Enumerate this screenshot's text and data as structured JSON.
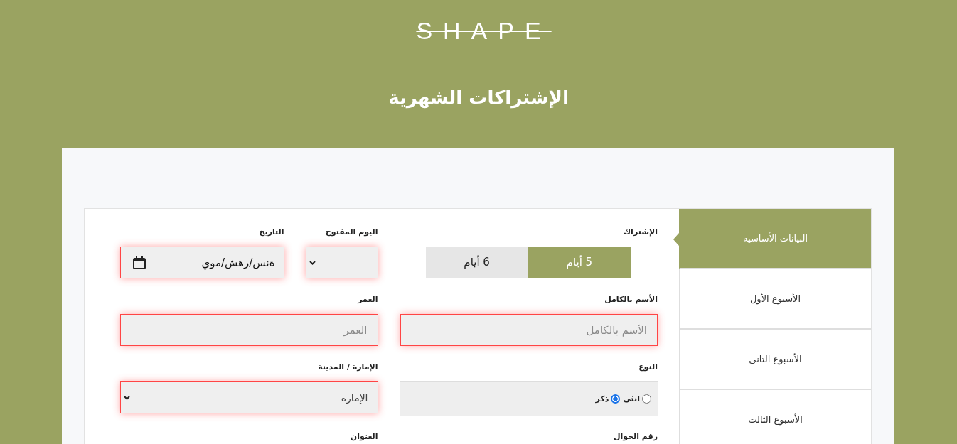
{
  "header": {
    "logo": "SHAPE",
    "title": "الإشتراكات الشهرية"
  },
  "sidebar": {
    "tabs": [
      {
        "label": "البيانات الأساسية",
        "selected": true
      },
      {
        "label": "الأسبوع الأول",
        "selected": false
      },
      {
        "label": "الأسبوع الثاني",
        "selected": false
      },
      {
        "label": "الأسبوع الثالث",
        "selected": false
      }
    ]
  },
  "form": {
    "rows": [
      {
        "cells": [
          {
            "kind": "toggle",
            "label": "الإشتراك",
            "options": [
              {
                "label": "5 أيام",
                "selected": true
              },
              {
                "label": "6 أيام",
                "selected": false
              }
            ]
          },
          {
            "kind": "group",
            "fields": [
              {
                "kind": "select",
                "label": "اليوم المفتوح",
                "invalid": true
              },
              {
                "kind": "date",
                "label": "التاريخ",
                "value": "ةنس/رهش/موي",
                "invalid": true
              }
            ]
          }
        ]
      },
      {
        "cells": [
          {
            "kind": "text",
            "label": "الأسم بالكامل",
            "placeholder": "الأسم بالكامل",
            "invalid": true
          },
          {
            "kind": "text",
            "label": "العمر",
            "placeholder": "العمر",
            "invalid": true
          }
        ]
      },
      {
        "cells": [
          {
            "kind": "radio",
            "label": "النوع",
            "options": [
              {
                "label": "انثى",
                "selected": false
              },
              {
                "label": "ذكر",
                "selected": true
              }
            ]
          },
          {
            "kind": "select",
            "label": "الإمارة / المدينة",
            "value": "الإمارة",
            "invalid": true
          }
        ]
      },
      {
        "cells": [
          {
            "kind": "label",
            "label": "رقم الجوال"
          },
          {
            "kind": "label",
            "label": "العنوان"
          }
        ]
      }
    ]
  }
}
